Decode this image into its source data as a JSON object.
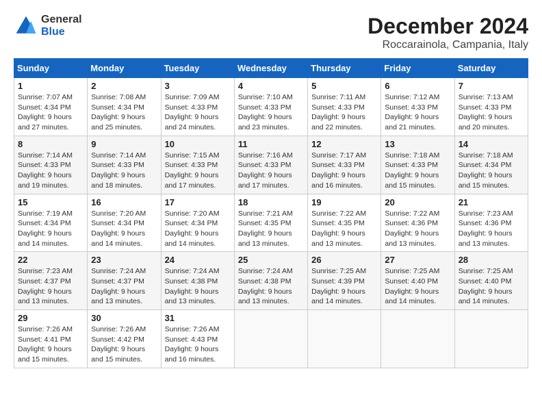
{
  "header": {
    "logo_general": "General",
    "logo_blue": "Blue",
    "month_year": "December 2024",
    "location": "Roccarainola, Campania, Italy"
  },
  "calendar": {
    "days_of_week": [
      "Sunday",
      "Monday",
      "Tuesday",
      "Wednesday",
      "Thursday",
      "Friday",
      "Saturday"
    ],
    "weeks": [
      [
        {
          "day": "1",
          "sunrise": "Sunrise: 7:07 AM",
          "sunset": "Sunset: 4:34 PM",
          "daylight": "Daylight: 9 hours and 27 minutes."
        },
        {
          "day": "2",
          "sunrise": "Sunrise: 7:08 AM",
          "sunset": "Sunset: 4:34 PM",
          "daylight": "Daylight: 9 hours and 25 minutes."
        },
        {
          "day": "3",
          "sunrise": "Sunrise: 7:09 AM",
          "sunset": "Sunset: 4:33 PM",
          "daylight": "Daylight: 9 hours and 24 minutes."
        },
        {
          "day": "4",
          "sunrise": "Sunrise: 7:10 AM",
          "sunset": "Sunset: 4:33 PM",
          "daylight": "Daylight: 9 hours and 23 minutes."
        },
        {
          "day": "5",
          "sunrise": "Sunrise: 7:11 AM",
          "sunset": "Sunset: 4:33 PM",
          "daylight": "Daylight: 9 hours and 22 minutes."
        },
        {
          "day": "6",
          "sunrise": "Sunrise: 7:12 AM",
          "sunset": "Sunset: 4:33 PM",
          "daylight": "Daylight: 9 hours and 21 minutes."
        },
        {
          "day": "7",
          "sunrise": "Sunrise: 7:13 AM",
          "sunset": "Sunset: 4:33 PM",
          "daylight": "Daylight: 9 hours and 20 minutes."
        }
      ],
      [
        {
          "day": "8",
          "sunrise": "Sunrise: 7:14 AM",
          "sunset": "Sunset: 4:33 PM",
          "daylight": "Daylight: 9 hours and 19 minutes."
        },
        {
          "day": "9",
          "sunrise": "Sunrise: 7:14 AM",
          "sunset": "Sunset: 4:33 PM",
          "daylight": "Daylight: 9 hours and 18 minutes."
        },
        {
          "day": "10",
          "sunrise": "Sunrise: 7:15 AM",
          "sunset": "Sunset: 4:33 PM",
          "daylight": "Daylight: 9 hours and 17 minutes."
        },
        {
          "day": "11",
          "sunrise": "Sunrise: 7:16 AM",
          "sunset": "Sunset: 4:33 PM",
          "daylight": "Daylight: 9 hours and 17 minutes."
        },
        {
          "day": "12",
          "sunrise": "Sunrise: 7:17 AM",
          "sunset": "Sunset: 4:33 PM",
          "daylight": "Daylight: 9 hours and 16 minutes."
        },
        {
          "day": "13",
          "sunrise": "Sunrise: 7:18 AM",
          "sunset": "Sunset: 4:33 PM",
          "daylight": "Daylight: 9 hours and 15 minutes."
        },
        {
          "day": "14",
          "sunrise": "Sunrise: 7:18 AM",
          "sunset": "Sunset: 4:34 PM",
          "daylight": "Daylight: 9 hours and 15 minutes."
        }
      ],
      [
        {
          "day": "15",
          "sunrise": "Sunrise: 7:19 AM",
          "sunset": "Sunset: 4:34 PM",
          "daylight": "Daylight: 9 hours and 14 minutes."
        },
        {
          "day": "16",
          "sunrise": "Sunrise: 7:20 AM",
          "sunset": "Sunset: 4:34 PM",
          "daylight": "Daylight: 9 hours and 14 minutes."
        },
        {
          "day": "17",
          "sunrise": "Sunrise: 7:20 AM",
          "sunset": "Sunset: 4:34 PM",
          "daylight": "Daylight: 9 hours and 14 minutes."
        },
        {
          "day": "18",
          "sunrise": "Sunrise: 7:21 AM",
          "sunset": "Sunset: 4:35 PM",
          "daylight": "Daylight: 9 hours and 13 minutes."
        },
        {
          "day": "19",
          "sunrise": "Sunrise: 7:22 AM",
          "sunset": "Sunset: 4:35 PM",
          "daylight": "Daylight: 9 hours and 13 minutes."
        },
        {
          "day": "20",
          "sunrise": "Sunrise: 7:22 AM",
          "sunset": "Sunset: 4:36 PM",
          "daylight": "Daylight: 9 hours and 13 minutes."
        },
        {
          "day": "21",
          "sunrise": "Sunrise: 7:23 AM",
          "sunset": "Sunset: 4:36 PM",
          "daylight": "Daylight: 9 hours and 13 minutes."
        }
      ],
      [
        {
          "day": "22",
          "sunrise": "Sunrise: 7:23 AM",
          "sunset": "Sunset: 4:37 PM",
          "daylight": "Daylight: 9 hours and 13 minutes."
        },
        {
          "day": "23",
          "sunrise": "Sunrise: 7:24 AM",
          "sunset": "Sunset: 4:37 PM",
          "daylight": "Daylight: 9 hours and 13 minutes."
        },
        {
          "day": "24",
          "sunrise": "Sunrise: 7:24 AM",
          "sunset": "Sunset: 4:38 PM",
          "daylight": "Daylight: 9 hours and 13 minutes."
        },
        {
          "day": "25",
          "sunrise": "Sunrise: 7:24 AM",
          "sunset": "Sunset: 4:38 PM",
          "daylight": "Daylight: 9 hours and 13 minutes."
        },
        {
          "day": "26",
          "sunrise": "Sunrise: 7:25 AM",
          "sunset": "Sunset: 4:39 PM",
          "daylight": "Daylight: 9 hours and 14 minutes."
        },
        {
          "day": "27",
          "sunrise": "Sunrise: 7:25 AM",
          "sunset": "Sunset: 4:40 PM",
          "daylight": "Daylight: 9 hours and 14 minutes."
        },
        {
          "day": "28",
          "sunrise": "Sunrise: 7:25 AM",
          "sunset": "Sunset: 4:40 PM",
          "daylight": "Daylight: 9 hours and 14 minutes."
        }
      ],
      [
        {
          "day": "29",
          "sunrise": "Sunrise: 7:26 AM",
          "sunset": "Sunset: 4:41 PM",
          "daylight": "Daylight: 9 hours and 15 minutes."
        },
        {
          "day": "30",
          "sunrise": "Sunrise: 7:26 AM",
          "sunset": "Sunset: 4:42 PM",
          "daylight": "Daylight: 9 hours and 15 minutes."
        },
        {
          "day": "31",
          "sunrise": "Sunrise: 7:26 AM",
          "sunset": "Sunset: 4:43 PM",
          "daylight": "Daylight: 9 hours and 16 minutes."
        },
        null,
        null,
        null,
        null
      ]
    ]
  }
}
